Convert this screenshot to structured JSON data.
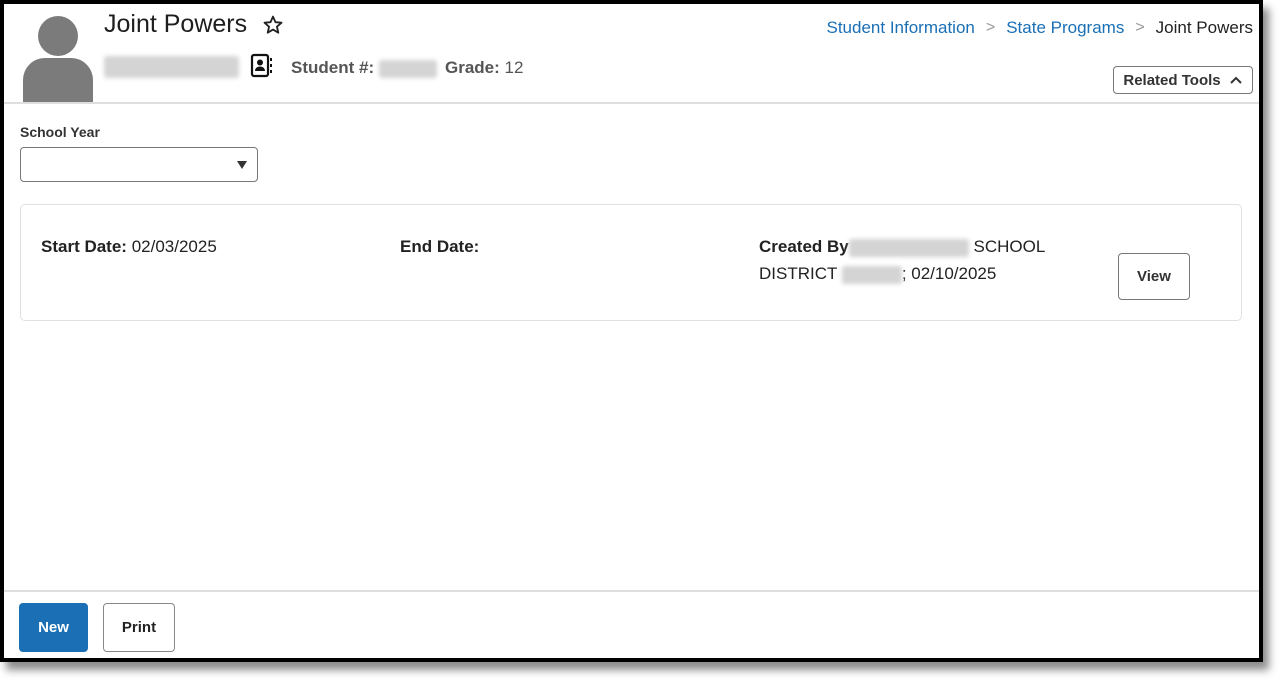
{
  "header": {
    "title": "Joint Powers",
    "student_label": "Student #:",
    "grade_label": "Grade:",
    "grade_value": "12",
    "icons": {
      "avatar": "person-silhouette-icon",
      "favorite": "star-outline-icon",
      "contact": "contact-card-icon"
    }
  },
  "breadcrumb": {
    "items": [
      "Student Information",
      "State Programs"
    ],
    "current": "Joint Powers",
    "separator": ">"
  },
  "related_tools": {
    "label": "Related Tools",
    "icon": "chevron-up-icon"
  },
  "school_year": {
    "label": "School Year",
    "value": ""
  },
  "record": {
    "start_label": "Start Date:",
    "start_value": "02/03/2025",
    "end_label": "End Date:",
    "end_value": "",
    "created_label": "Created By",
    "created_text_1": " SCHOOL",
    "created_text_2": "DISTRICT ",
    "created_date": "; 02/10/2025",
    "view_label": "View"
  },
  "footer": {
    "new_label": "New",
    "print_label": "Print"
  },
  "colors": {
    "primary": "#1a6fb5",
    "avatar": "#7b7b7b"
  }
}
